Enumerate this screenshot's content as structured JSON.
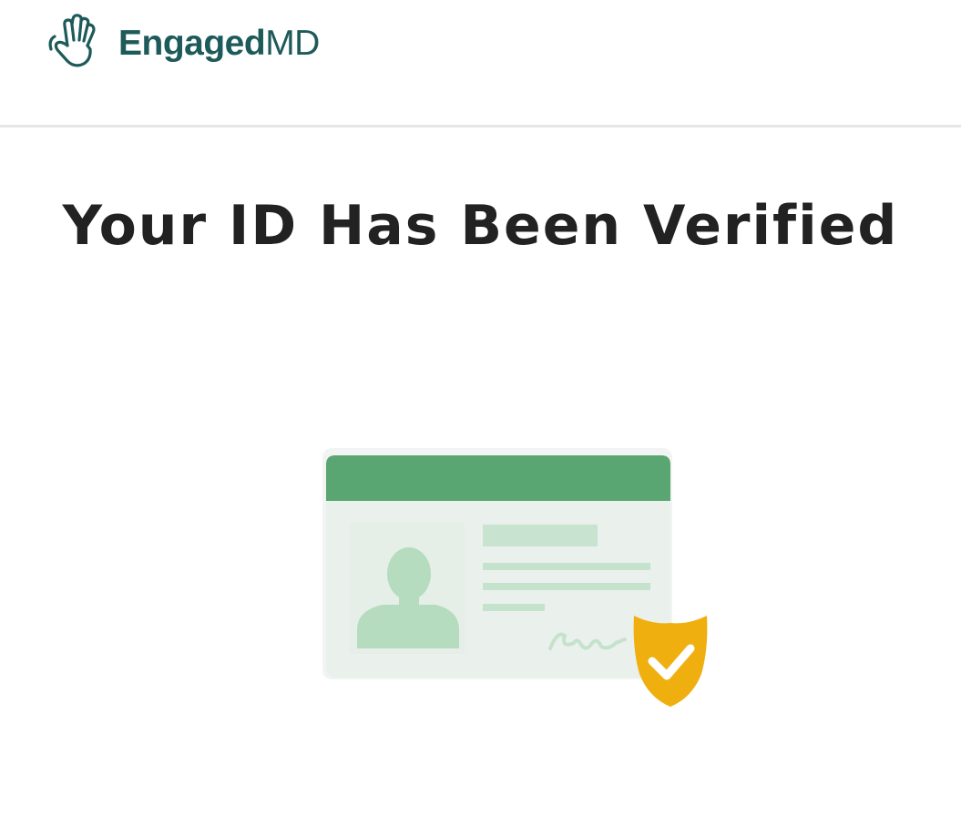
{
  "header": {
    "brand_bold": "Engaged",
    "brand_light": "MD",
    "logo_icon": "waving-hand-icon",
    "brand_color": "#1e5a5a"
  },
  "main": {
    "title": "Your ID Has Been Verified",
    "illustration": "id-card-verified-illustration",
    "badge_icon": "shield-check-icon"
  },
  "colors": {
    "card_header": "#5aa672",
    "card_body": "#eaf1ec",
    "avatar": "#b5dcbf",
    "text_lines": "#c5e2cd",
    "shield": "#efb00f",
    "title_text": "#222222",
    "divider": "#e4e6e8"
  }
}
